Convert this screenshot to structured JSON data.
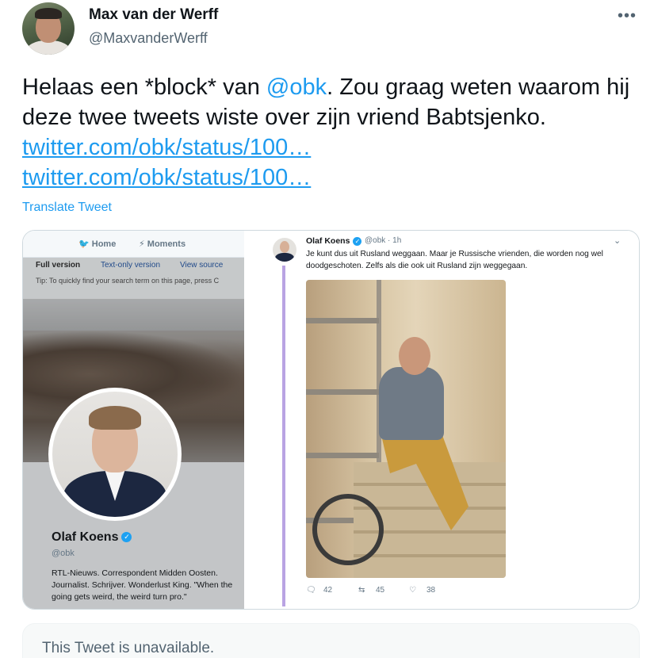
{
  "author": {
    "name": "Max van der Werff",
    "handle": "@MaxvanderWerff"
  },
  "more_icon": "more-horizontal-icon",
  "tweet": {
    "text_before": "Helaas een *block* van ",
    "mention": "@obk",
    "text_after": ". Zou graag weten waarom hij deze twee tweets wiste over zijn vriend Babtsjenko.",
    "links": [
      "twitter.com/obk/status/100…",
      "twitter.com/obk/status/100…"
    ],
    "translate_label": "Translate Tweet"
  },
  "media_left": {
    "nav": [
      "Home",
      "Moments"
    ],
    "versions": [
      "Full version",
      "Text-only version",
      "View source"
    ],
    "tip": "Tip: To quickly find your search term on this page, press C",
    "profile_name": "Olaf Koens",
    "profile_handle": "@obk",
    "bio": "RTL-Nieuws. Correspondent Midden Oosten. Journalist. Schrijver. Wonderlust King. \"When the going gets weird, the weird turn pro.\""
  },
  "media_right": {
    "name": "Olaf Koens",
    "handle_time": "@obk · 1h",
    "text": "Je kunt dus uit Rusland weggaan. Maar je Russische vrienden, die worden nog wel doodgeschoten. Zelfs als die ook uit Rusland zijn weggegaan.",
    "replies": "42",
    "retweets": "45",
    "likes": "38"
  },
  "unavailable": {
    "text": "This Tweet is unavailable."
  },
  "colors": {
    "link": "#1d9bf0",
    "secondary_text": "#536471",
    "thread_line": "#b9a3e3"
  }
}
